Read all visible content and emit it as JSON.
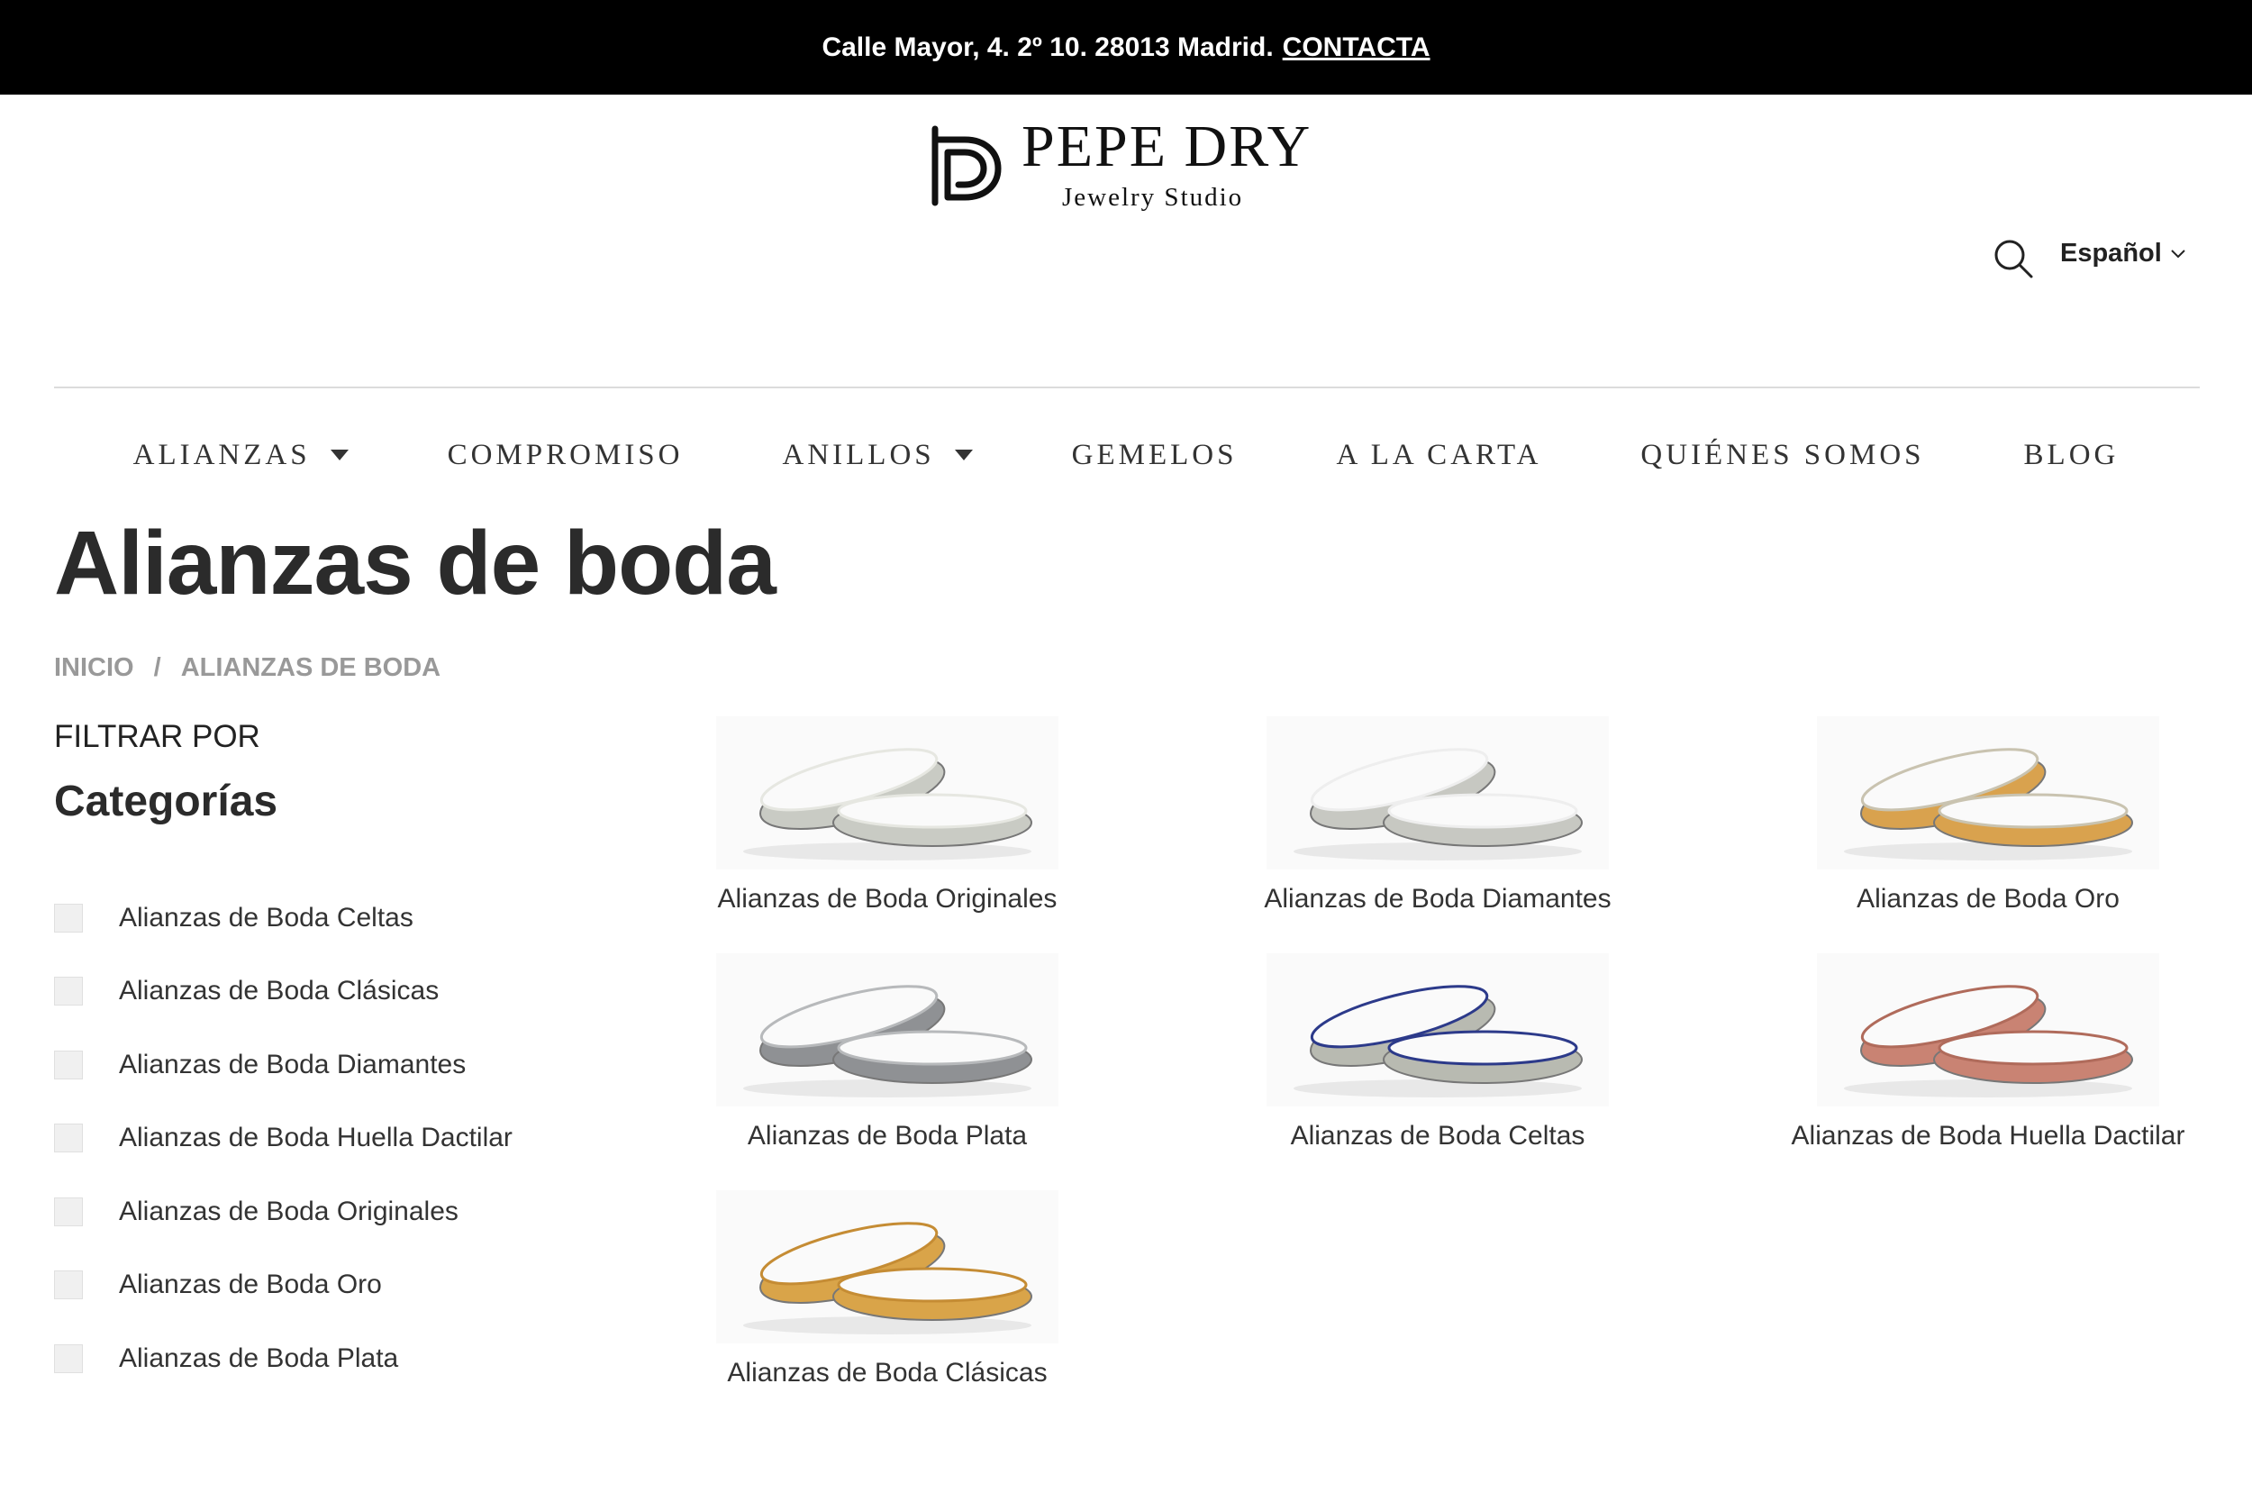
{
  "topbar": {
    "address": "Calle Mayor, 4. 2º 10. 28013 Madrid.",
    "contact": "CONTACTA"
  },
  "brand": {
    "name": "PEPE DRY",
    "tagline": "Jewelry Studio"
  },
  "header": {
    "language": "Español"
  },
  "nav": [
    {
      "label": "ALIANZAS",
      "dropdown": true
    },
    {
      "label": "COMPROMISO",
      "dropdown": false
    },
    {
      "label": "ANILLOS",
      "dropdown": true
    },
    {
      "label": "GEMELOS",
      "dropdown": false
    },
    {
      "label": "A LA CARTA",
      "dropdown": false
    },
    {
      "label": "QUIÉNES SOMOS",
      "dropdown": false
    },
    {
      "label": "BLOG",
      "dropdown": false
    }
  ],
  "page": {
    "title": "Alianzas de boda"
  },
  "breadcrumb": {
    "home": "INICIO",
    "separator": "/",
    "current": "ALIANZAS DE BODA"
  },
  "filters": {
    "heading": "FILTRAR POR",
    "categories_title": "Categorías",
    "categories": [
      "Alianzas de Boda Celtas",
      "Alianzas de Boda Clásicas",
      "Alianzas de Boda Diamantes",
      "Alianzas de Boda Huella Dactilar",
      "Alianzas de Boda Originales",
      "Alianzas de Boda Oro",
      "Alianzas de Boda Plata"
    ]
  },
  "products": [
    {
      "label": "Alianzas de Boda Originales",
      "metal": "#c9cbc4",
      "accent": "#e6e7e1"
    },
    {
      "label": "Alianzas de Boda Diamantes",
      "metal": "#c7c8c2",
      "accent": "#eeeeee"
    },
    {
      "label": "Alianzas de Boda Oro",
      "metal": "#d9a24e",
      "accent": "#c9c3b0"
    },
    {
      "label": "Alianzas de Boda Plata",
      "metal": "#8f9194",
      "accent": "#b7b9bb"
    },
    {
      "label": "Alianzas de Boda Celtas",
      "metal": "#b8bab1",
      "accent": "#2c3a8a"
    },
    {
      "label": "Alianzas de Boda Huella Dactilar",
      "metal": "#c98373",
      "accent": "#b06b5b"
    },
    {
      "label": "Alianzas de Boda Clásicas",
      "metal": "#d9a449",
      "accent": "#c58c34"
    }
  ]
}
